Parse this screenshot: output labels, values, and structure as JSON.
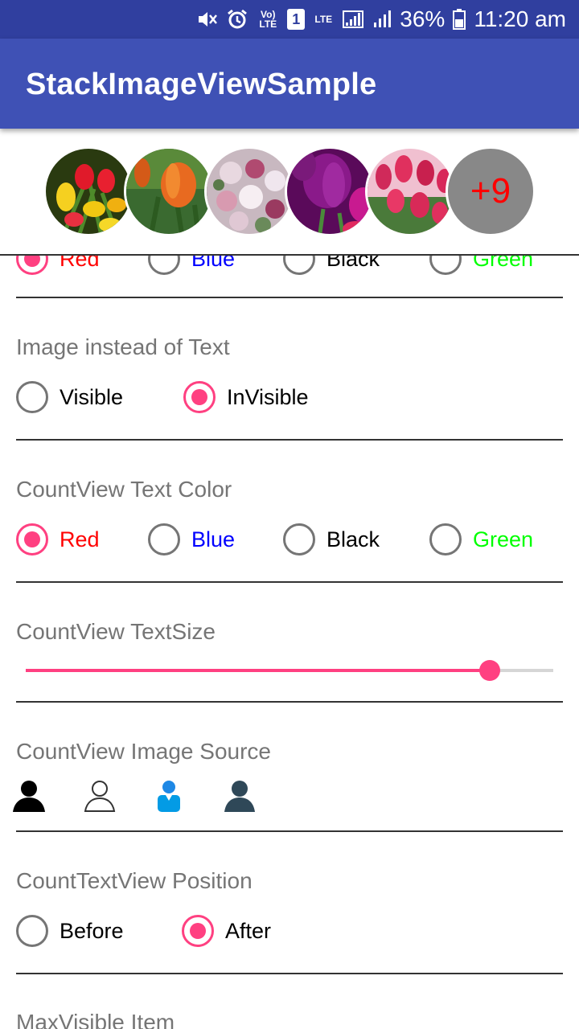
{
  "status_bar": {
    "battery": "36%",
    "time": "11:20 am",
    "volte": "Vo) LTE",
    "sim": "1",
    "lte": "LTE"
  },
  "app_bar": {
    "title": "StackImageViewSample"
  },
  "stack_view": {
    "images": [
      "tulips-bouquet-image",
      "orange-tulip-image",
      "flower-bouquet-image",
      "purple-tulips-image",
      "pink-tulips-image"
    ],
    "count_text": "+9",
    "count_color": "#ff0000",
    "count_bg": "#888888"
  },
  "sections": {
    "text_color_top": {
      "options": [
        {
          "label": "Red",
          "color": "#ff0000",
          "checked": true
        },
        {
          "label": "Blue",
          "color": "#0000ff",
          "checked": false
        },
        {
          "label": "Black",
          "color": "#000000",
          "checked": false
        },
        {
          "label": "Green",
          "color": "#00ff00",
          "checked": false
        }
      ]
    },
    "image_instead": {
      "title": "Image instead of Text",
      "options": [
        {
          "label": "Visible",
          "checked": false
        },
        {
          "label": "InVisible",
          "checked": true
        }
      ]
    },
    "countview_color": {
      "title": "CountView Text Color",
      "options": [
        {
          "label": "Red",
          "color": "#ff0000",
          "checked": true
        },
        {
          "label": "Blue",
          "color": "#0000ff",
          "checked": false
        },
        {
          "label": "Black",
          "color": "#000000",
          "checked": false
        },
        {
          "label": "Green",
          "color": "#00ff00",
          "checked": false
        }
      ]
    },
    "countview_textsize": {
      "title": "CountView TextSize",
      "slider_value": 0.88
    },
    "countview_image_source": {
      "title": "CountView Image Source",
      "icons": [
        "person-black-icon",
        "person-outline-icon",
        "person-blue-icon",
        "person-slate-icon"
      ]
    },
    "counttext_position": {
      "title": "CountTextView Position",
      "options": [
        {
          "label": "Before",
          "checked": false
        },
        {
          "label": "After",
          "checked": true
        }
      ]
    },
    "max_visible": {
      "title": "MaxVisible Item"
    }
  },
  "colors": {
    "accent": "#ff4081",
    "primary": "#3f51b5",
    "primary_dark": "#303f9f"
  }
}
